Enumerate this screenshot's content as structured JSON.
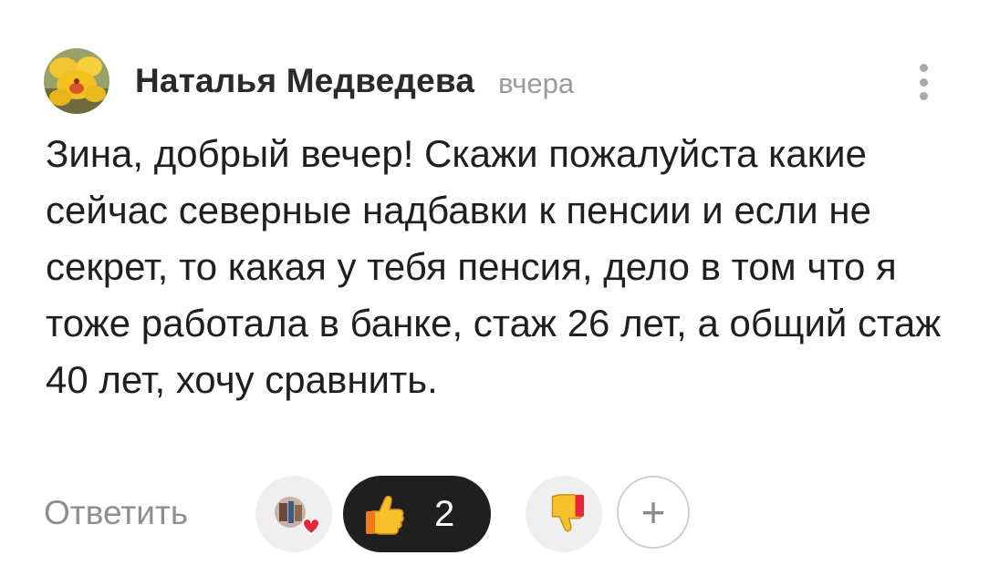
{
  "comment": {
    "author": "Наталья Медведева",
    "time": "вчера",
    "text": "Зина, добрый вечер! Скажи пожалуйста какие сейчас северные надбавки к пенсии и если не секрет, то какая у тебя пенсия, дело в том что я тоже работала в банке, стаж 26 лет, а общий стаж 40 лет, хочу сравнить.",
    "avatar_icon": "yellow-orchid-avatar",
    "menu_icon": "vertical-dots-icon"
  },
  "actions": {
    "reply_label": "Ответить",
    "reactors_icon": "reactor-avatar-with-heart-icon",
    "like": {
      "icon": "thumbs-up-emoji-icon",
      "count": "2"
    },
    "dislike": {
      "icon": "thumbs-down-emoji-icon"
    },
    "add_reaction": {
      "label": "+"
    }
  },
  "colors": {
    "author": "#2a2a2a",
    "time": "#9a9a9a",
    "reply": "#8f8f8f",
    "like_pill_bg": "#1f1f1f",
    "pill_bg": "#efefef",
    "heart": "#e8253a"
  }
}
